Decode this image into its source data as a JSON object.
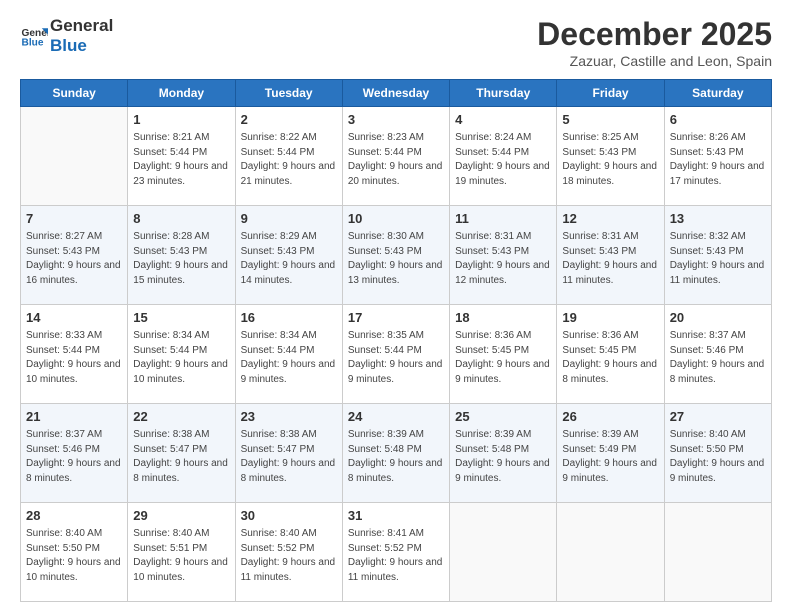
{
  "header": {
    "logo_line1": "General",
    "logo_line2": "Blue",
    "month_title": "December 2025",
    "location": "Zazuar, Castille and Leon, Spain"
  },
  "weekdays": [
    "Sunday",
    "Monday",
    "Tuesday",
    "Wednesday",
    "Thursday",
    "Friday",
    "Saturday"
  ],
  "weeks": [
    [
      {
        "day": "",
        "sunrise": "",
        "sunset": "",
        "daylight": ""
      },
      {
        "day": "1",
        "sunrise": "Sunrise: 8:21 AM",
        "sunset": "Sunset: 5:44 PM",
        "daylight": "Daylight: 9 hours and 23 minutes."
      },
      {
        "day": "2",
        "sunrise": "Sunrise: 8:22 AM",
        "sunset": "Sunset: 5:44 PM",
        "daylight": "Daylight: 9 hours and 21 minutes."
      },
      {
        "day": "3",
        "sunrise": "Sunrise: 8:23 AM",
        "sunset": "Sunset: 5:44 PM",
        "daylight": "Daylight: 9 hours and 20 minutes."
      },
      {
        "day": "4",
        "sunrise": "Sunrise: 8:24 AM",
        "sunset": "Sunset: 5:44 PM",
        "daylight": "Daylight: 9 hours and 19 minutes."
      },
      {
        "day": "5",
        "sunrise": "Sunrise: 8:25 AM",
        "sunset": "Sunset: 5:43 PM",
        "daylight": "Daylight: 9 hours and 18 minutes."
      },
      {
        "day": "6",
        "sunrise": "Sunrise: 8:26 AM",
        "sunset": "Sunset: 5:43 PM",
        "daylight": "Daylight: 9 hours and 17 minutes."
      }
    ],
    [
      {
        "day": "7",
        "sunrise": "Sunrise: 8:27 AM",
        "sunset": "Sunset: 5:43 PM",
        "daylight": "Daylight: 9 hours and 16 minutes."
      },
      {
        "day": "8",
        "sunrise": "Sunrise: 8:28 AM",
        "sunset": "Sunset: 5:43 PM",
        "daylight": "Daylight: 9 hours and 15 minutes."
      },
      {
        "day": "9",
        "sunrise": "Sunrise: 8:29 AM",
        "sunset": "Sunset: 5:43 PM",
        "daylight": "Daylight: 9 hours and 14 minutes."
      },
      {
        "day": "10",
        "sunrise": "Sunrise: 8:30 AM",
        "sunset": "Sunset: 5:43 PM",
        "daylight": "Daylight: 9 hours and 13 minutes."
      },
      {
        "day": "11",
        "sunrise": "Sunrise: 8:31 AM",
        "sunset": "Sunset: 5:43 PM",
        "daylight": "Daylight: 9 hours and 12 minutes."
      },
      {
        "day": "12",
        "sunrise": "Sunrise: 8:31 AM",
        "sunset": "Sunset: 5:43 PM",
        "daylight": "Daylight: 9 hours and 11 minutes."
      },
      {
        "day": "13",
        "sunrise": "Sunrise: 8:32 AM",
        "sunset": "Sunset: 5:43 PM",
        "daylight": "Daylight: 9 hours and 11 minutes."
      }
    ],
    [
      {
        "day": "14",
        "sunrise": "Sunrise: 8:33 AM",
        "sunset": "Sunset: 5:44 PM",
        "daylight": "Daylight: 9 hours and 10 minutes."
      },
      {
        "day": "15",
        "sunrise": "Sunrise: 8:34 AM",
        "sunset": "Sunset: 5:44 PM",
        "daylight": "Daylight: 9 hours and 10 minutes."
      },
      {
        "day": "16",
        "sunrise": "Sunrise: 8:34 AM",
        "sunset": "Sunset: 5:44 PM",
        "daylight": "Daylight: 9 hours and 9 minutes."
      },
      {
        "day": "17",
        "sunrise": "Sunrise: 8:35 AM",
        "sunset": "Sunset: 5:44 PM",
        "daylight": "Daylight: 9 hours and 9 minutes."
      },
      {
        "day": "18",
        "sunrise": "Sunrise: 8:36 AM",
        "sunset": "Sunset: 5:45 PM",
        "daylight": "Daylight: 9 hours and 9 minutes."
      },
      {
        "day": "19",
        "sunrise": "Sunrise: 8:36 AM",
        "sunset": "Sunset: 5:45 PM",
        "daylight": "Daylight: 9 hours and 8 minutes."
      },
      {
        "day": "20",
        "sunrise": "Sunrise: 8:37 AM",
        "sunset": "Sunset: 5:46 PM",
        "daylight": "Daylight: 9 hours and 8 minutes."
      }
    ],
    [
      {
        "day": "21",
        "sunrise": "Sunrise: 8:37 AM",
        "sunset": "Sunset: 5:46 PM",
        "daylight": "Daylight: 9 hours and 8 minutes."
      },
      {
        "day": "22",
        "sunrise": "Sunrise: 8:38 AM",
        "sunset": "Sunset: 5:47 PM",
        "daylight": "Daylight: 9 hours and 8 minutes."
      },
      {
        "day": "23",
        "sunrise": "Sunrise: 8:38 AM",
        "sunset": "Sunset: 5:47 PM",
        "daylight": "Daylight: 9 hours and 8 minutes."
      },
      {
        "day": "24",
        "sunrise": "Sunrise: 8:39 AM",
        "sunset": "Sunset: 5:48 PM",
        "daylight": "Daylight: 9 hours and 8 minutes."
      },
      {
        "day": "25",
        "sunrise": "Sunrise: 8:39 AM",
        "sunset": "Sunset: 5:48 PM",
        "daylight": "Daylight: 9 hours and 9 minutes."
      },
      {
        "day": "26",
        "sunrise": "Sunrise: 8:39 AM",
        "sunset": "Sunset: 5:49 PM",
        "daylight": "Daylight: 9 hours and 9 minutes."
      },
      {
        "day": "27",
        "sunrise": "Sunrise: 8:40 AM",
        "sunset": "Sunset: 5:50 PM",
        "daylight": "Daylight: 9 hours and 9 minutes."
      }
    ],
    [
      {
        "day": "28",
        "sunrise": "Sunrise: 8:40 AM",
        "sunset": "Sunset: 5:50 PM",
        "daylight": "Daylight: 9 hours and 10 minutes."
      },
      {
        "day": "29",
        "sunrise": "Sunrise: 8:40 AM",
        "sunset": "Sunset: 5:51 PM",
        "daylight": "Daylight: 9 hours and 10 minutes."
      },
      {
        "day": "30",
        "sunrise": "Sunrise: 8:40 AM",
        "sunset": "Sunset: 5:52 PM",
        "daylight": "Daylight: 9 hours and 11 minutes."
      },
      {
        "day": "31",
        "sunrise": "Sunrise: 8:41 AM",
        "sunset": "Sunset: 5:52 PM",
        "daylight": "Daylight: 9 hours and 11 minutes."
      },
      {
        "day": "",
        "sunrise": "",
        "sunset": "",
        "daylight": ""
      },
      {
        "day": "",
        "sunrise": "",
        "sunset": "",
        "daylight": ""
      },
      {
        "day": "",
        "sunrise": "",
        "sunset": "",
        "daylight": ""
      }
    ]
  ]
}
